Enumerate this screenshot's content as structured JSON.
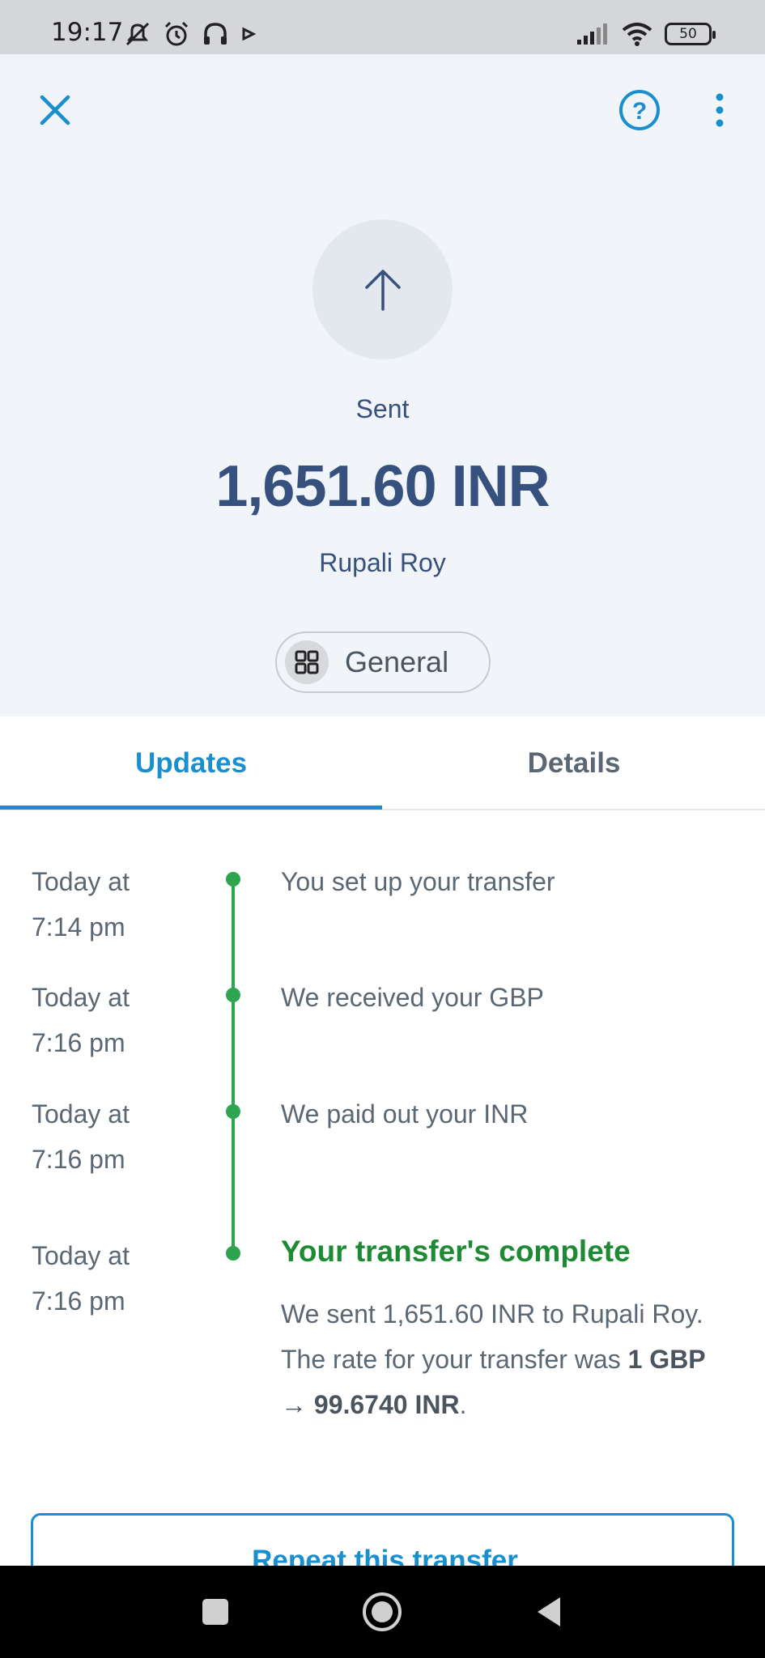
{
  "status_bar": {
    "time": "19:17",
    "battery": "50",
    "icons_left": [
      "mute-icon",
      "alarm-icon",
      "headphones-icon",
      "play-icon"
    ],
    "icons_right": [
      "signal-icon",
      "wifi-icon",
      "battery-icon"
    ]
  },
  "header": {
    "status": "Sent",
    "amount": "1,651.60 INR",
    "recipient": "Rupali Roy",
    "category": "General"
  },
  "tabs": [
    {
      "label": "Updates",
      "active": true
    },
    {
      "label": "Details",
      "active": false
    }
  ],
  "timeline": [
    {
      "time_line1": "Today at",
      "time_line2": "7:14 pm",
      "text": "You set up your transfer"
    },
    {
      "time_line1": "Today at",
      "time_line2": "7:16 pm",
      "text": "We received your GBP"
    },
    {
      "time_line1": "Today at",
      "time_line2": "7:16 pm",
      "text": "We paid out your INR"
    },
    {
      "time_line1": "Today at",
      "time_line2": "7:16 pm",
      "title": "Your transfer's complete",
      "desc_prefix": "We sent 1,651.60 INR to Rupali Roy. The rate for your transfer was ",
      "desc_rate": "1 GBP → 99.6740 INR",
      "desc_suffix": "."
    }
  ],
  "repeat_button": "Repeat this transfer",
  "colors": {
    "accent": "#1a8fcf",
    "success": "#2ea44f",
    "heading": "#37517e"
  }
}
